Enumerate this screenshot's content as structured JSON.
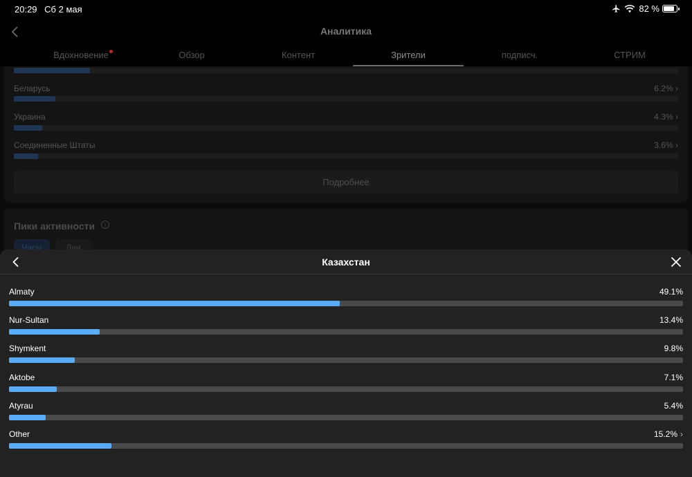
{
  "status_bar": {
    "time": "20:29",
    "date": "Сб 2 мая",
    "battery": "82 %",
    "battery_level": 0.82
  },
  "header": {
    "title": "Аналитика"
  },
  "tabs": [
    {
      "label": "Вдохновение",
      "has_dot": true
    },
    {
      "label": "Обзор"
    },
    {
      "label": "Контент"
    },
    {
      "label": "Зрители",
      "active": true
    },
    {
      "label": "подписч."
    },
    {
      "label": "СТРИМ"
    }
  ],
  "countries": [
    {
      "name": "",
      "percent": "",
      "fraction": 0.115
    },
    {
      "name": "Беларусь",
      "percent": "6.2%",
      "fraction": 0.062
    },
    {
      "name": "Украина",
      "percent": "4.3%",
      "fraction": 0.043
    },
    {
      "name": "Соединенные Штаты",
      "percent": "3.6%",
      "fraction": 0.036
    }
  ],
  "more_button": "Подробнее",
  "peaks": {
    "title": "Пики активности",
    "pills": [
      "Часы",
      "Дни"
    ]
  },
  "sheet": {
    "title": "Казахстан",
    "cities": [
      {
        "name": "Almaty",
        "percent": "49.1%",
        "fraction": 0.491
      },
      {
        "name": "Nur-Sultan",
        "percent": "13.4%",
        "fraction": 0.134
      },
      {
        "name": "Shymkent",
        "percent": "9.8%",
        "fraction": 0.098
      },
      {
        "name": "Aktobe",
        "percent": "7.1%",
        "fraction": 0.071
      },
      {
        "name": "Atyrau",
        "percent": "5.4%",
        "fraction": 0.054
      },
      {
        "name": "Other",
        "percent": "15.2%",
        "fraction": 0.152,
        "expandable": true
      }
    ]
  },
  "colors": {
    "accent": "#5aabf5",
    "track": "#4a4a4a",
    "sheet_bg": "#222222",
    "notification_dot": "#b3262d"
  }
}
